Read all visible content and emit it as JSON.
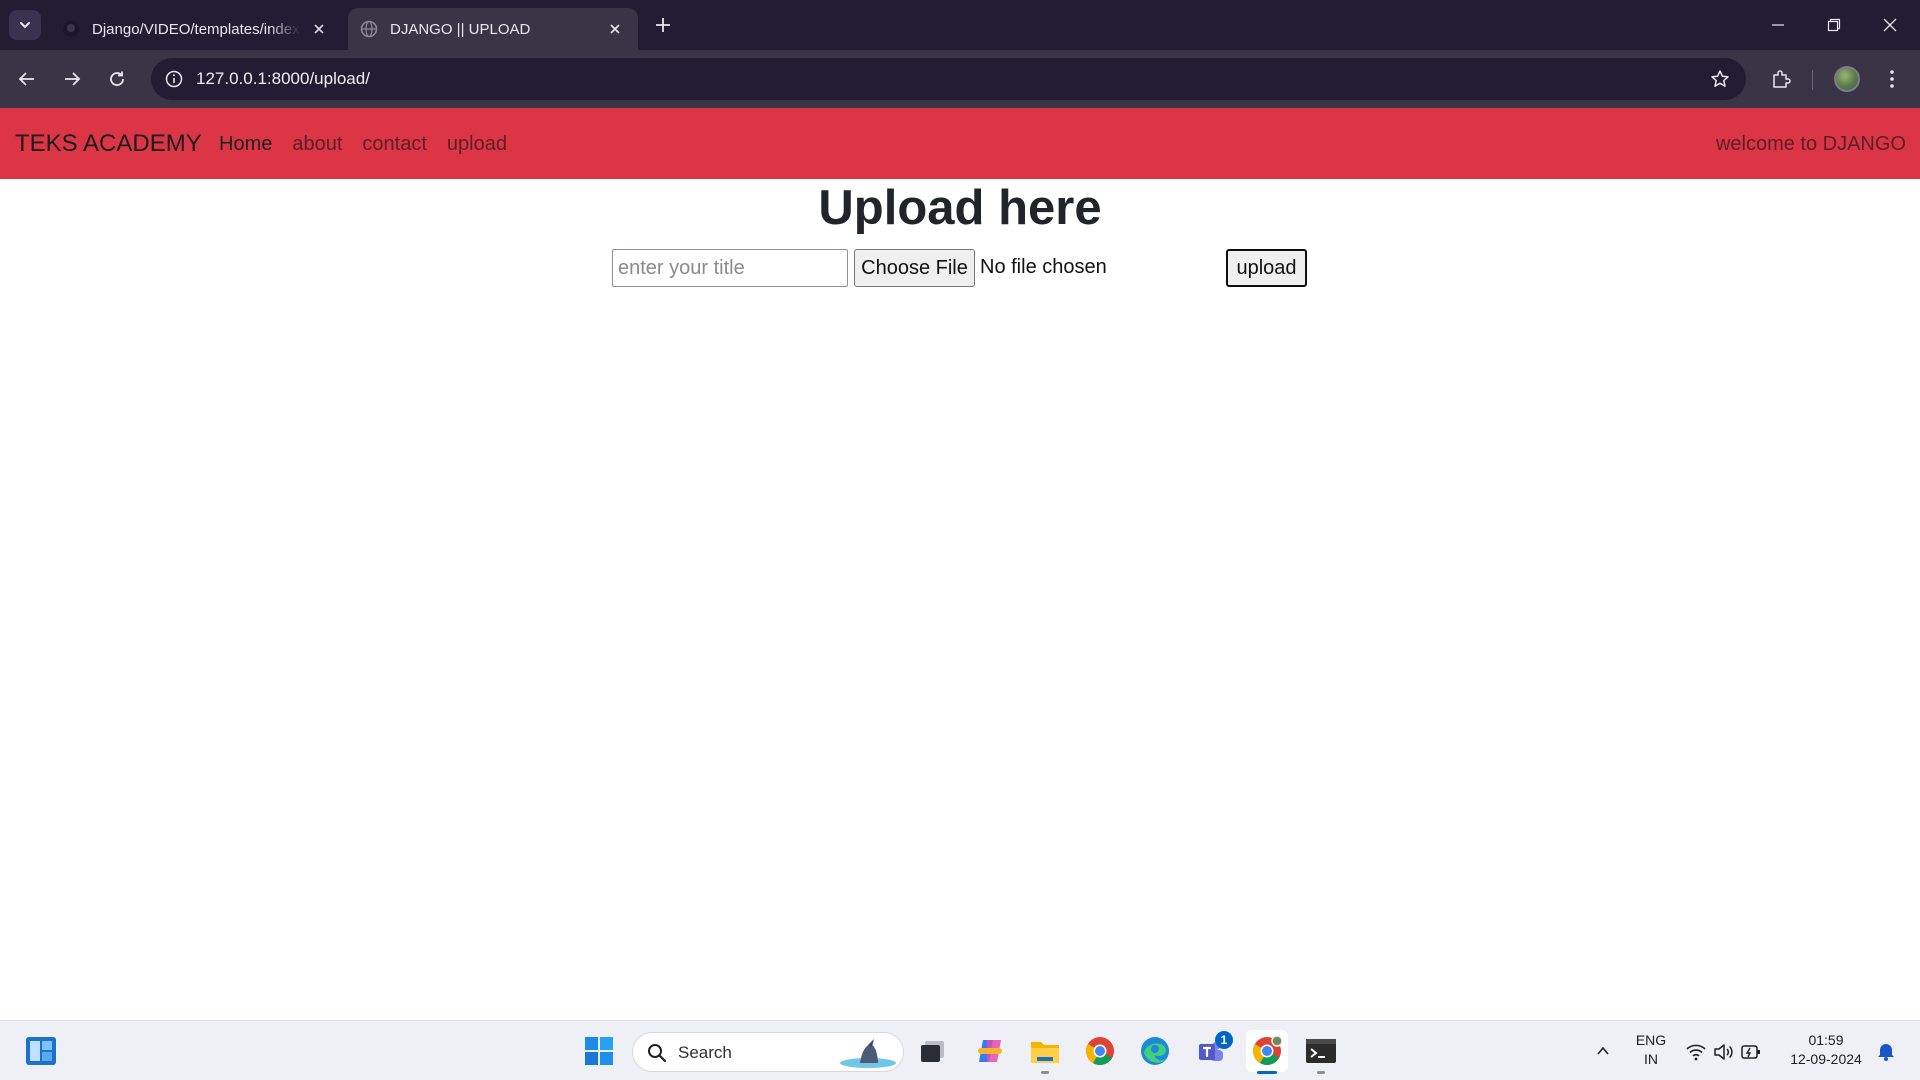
{
  "browser": {
    "tabs": [
      {
        "title": "Django/VIDEO/templates/index",
        "active": false
      },
      {
        "title": "DJANGO || UPLOAD",
        "active": true
      }
    ],
    "url": "127.0.0.1:8000/upload/"
  },
  "navbar": {
    "brand": "TEKS ACADEMY",
    "links": [
      "Home",
      "about",
      "contact",
      "upload"
    ],
    "welcome": "welcome to DJANGO",
    "color": "#dc3545"
  },
  "upload_form": {
    "heading": "Upload here",
    "title_placeholder": "enter your title",
    "choose_file_label": "Choose File",
    "file_status": "No file chosen",
    "submit_label": "upload"
  },
  "taskbar": {
    "search_label": "Search",
    "teams_badge": "1",
    "language": "ENG",
    "region": "IN",
    "time": "01:59",
    "date": "12-09-2024"
  }
}
